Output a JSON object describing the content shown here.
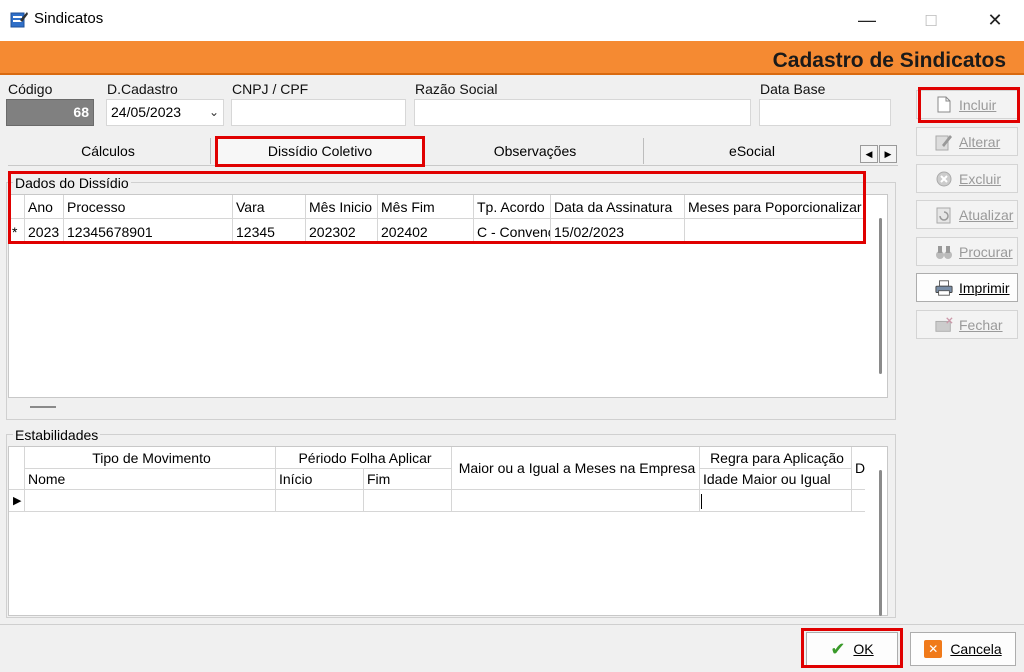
{
  "window": {
    "title": "Sindicatos",
    "minimize": "—",
    "maximize": "☐",
    "close": "✕"
  },
  "header": {
    "title": "Cadastro de Sindicatos"
  },
  "fields": {
    "codigo": {
      "label": "Código",
      "value": "68"
    },
    "dcadastro": {
      "label": "D.Cadastro",
      "value": "24/05/2023"
    },
    "cnpj": {
      "label": "CNPJ / CPF",
      "value": ""
    },
    "razao": {
      "label": "Razão Social",
      "value": ""
    },
    "database": {
      "label": "Data Base",
      "value": ""
    }
  },
  "tabs": [
    {
      "label": "Cálculos"
    },
    {
      "label": "Dissídio Coletivo"
    },
    {
      "label": "Observações"
    },
    {
      "label": "eSocial"
    }
  ],
  "dissidio": {
    "group_title": "Dados do Dissídio",
    "columns": [
      "Ano",
      "Processo",
      "Vara",
      "Mês Inicio",
      "Mês Fim",
      "Tp. Acordo",
      "Data da Assinatura",
      "Meses para Poporcionalizar"
    ],
    "row_marker": "*",
    "rows": [
      [
        "2023",
        "12345678901",
        "12345",
        "202302",
        "202402",
        "C - Convenção",
        "15/02/2023",
        ""
      ]
    ]
  },
  "estabilidades": {
    "group_title": "Estabilidades",
    "top_headers": [
      "Tipo de Movimento",
      "Périodo Folha Aplicar",
      "Maior ou a Igual a Meses na Empresa",
      "Regra para Aplicação",
      "Di"
    ],
    "sub_headers": [
      "Nome",
      "Início",
      "Fim",
      "Idade Maior ou Igual"
    ],
    "row_marker": "▶"
  },
  "side_buttons": [
    {
      "label": "Incluir",
      "icon": "document-icon",
      "enabled": false
    },
    {
      "label": "Alterar",
      "icon": "edit-icon",
      "enabled": false
    },
    {
      "label": "Excluir",
      "icon": "delete-icon",
      "enabled": false
    },
    {
      "label": "Atualizar",
      "icon": "refresh-icon",
      "enabled": false
    },
    {
      "label": "Procurar",
      "icon": "binoculars-icon",
      "enabled": false
    },
    {
      "label": "Imprimir",
      "icon": "printer-icon",
      "enabled": true
    },
    {
      "label": "Fechar",
      "icon": "close-folder-icon",
      "enabled": false
    }
  ],
  "footer": {
    "ok": "OK",
    "cancel": "Cancela"
  },
  "colors": {
    "accent": "#f58a32",
    "highlight": "#e00000"
  }
}
